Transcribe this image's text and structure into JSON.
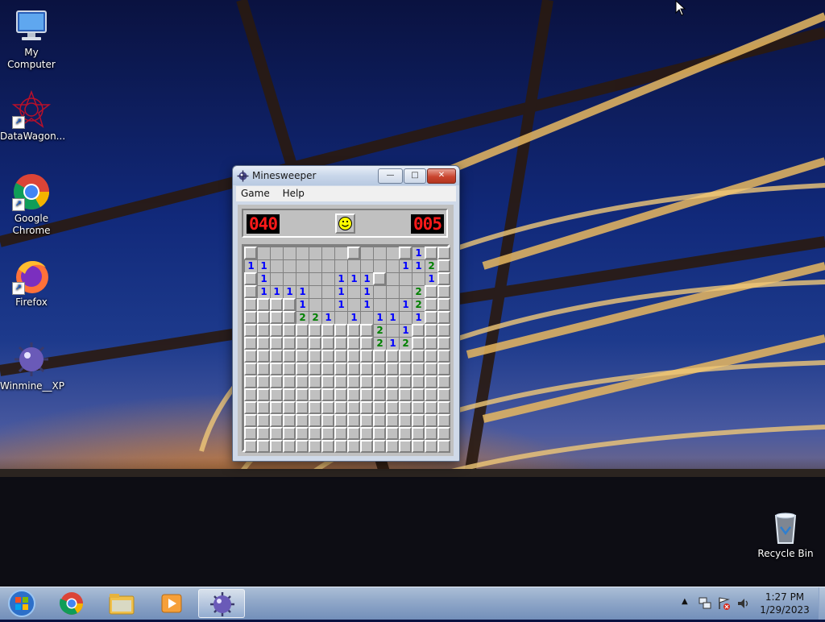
{
  "desktop": {
    "icons": [
      {
        "label": "My Computer",
        "icon": "computer-icon"
      },
      {
        "label": "DataWagon...",
        "icon": "datawagon-icon"
      },
      {
        "label": "Google Chrome",
        "icon": "chrome-icon"
      },
      {
        "label": "Firefox",
        "icon": "firefox-icon"
      },
      {
        "label": "Winmine__XP",
        "icon": "minesweeper-icon"
      },
      {
        "label": "Recycle Bin",
        "icon": "recycle-bin-icon"
      }
    ]
  },
  "window": {
    "title": "Minesweeper",
    "menu": [
      "Game",
      "Help"
    ],
    "controls": {
      "minimize": "—",
      "maximize": "□",
      "close": "✕"
    },
    "mine_counter": "040",
    "timer": "005",
    "face": "smile",
    "board": {
      "rows": 16,
      "cols": 16,
      "map": [
        "H.......H...H1HH",
        "11..........112H",
        "H1.....111H...1H",
        "H1111..1.1...2H",
        "HHHH1..1.1..12H",
        "HHHH221.1.11.1HH",
        "HHHHHHHHHH2.1HHH",
        "HHHHHHHHHH212HHH",
        "HHHHHHHHHHHHHHHH",
        "HHHHHHHHHHHHHHHH",
        "HHHHHHHHHHHHHHHH",
        "HHHHHHHHHHHHHHHH",
        "HHHHHHHHHHHHHHHH",
        "HHHHHHHHHHHHHHHH",
        "HHHHHHHHHHHHHHHH",
        "HHHHHHHHHHHHHHHH"
      ]
    }
  },
  "taskbar": {
    "items": [
      "start-orb",
      "chrome-icon",
      "file-explorer-icon",
      "media-player-icon",
      "minesweeper-icon"
    ],
    "active_item": "minesweeper-icon",
    "tray_icons": [
      "show-hidden-icons-arrow",
      "network-icon",
      "action-center-icon",
      "volume-icon"
    ],
    "time": "1:27 PM",
    "date": "1/29/2023"
  },
  "colors": {
    "accent": "#1d3a8c",
    "led": "#ff1a1a",
    "num1": "#0000ff",
    "num2": "#008000"
  }
}
